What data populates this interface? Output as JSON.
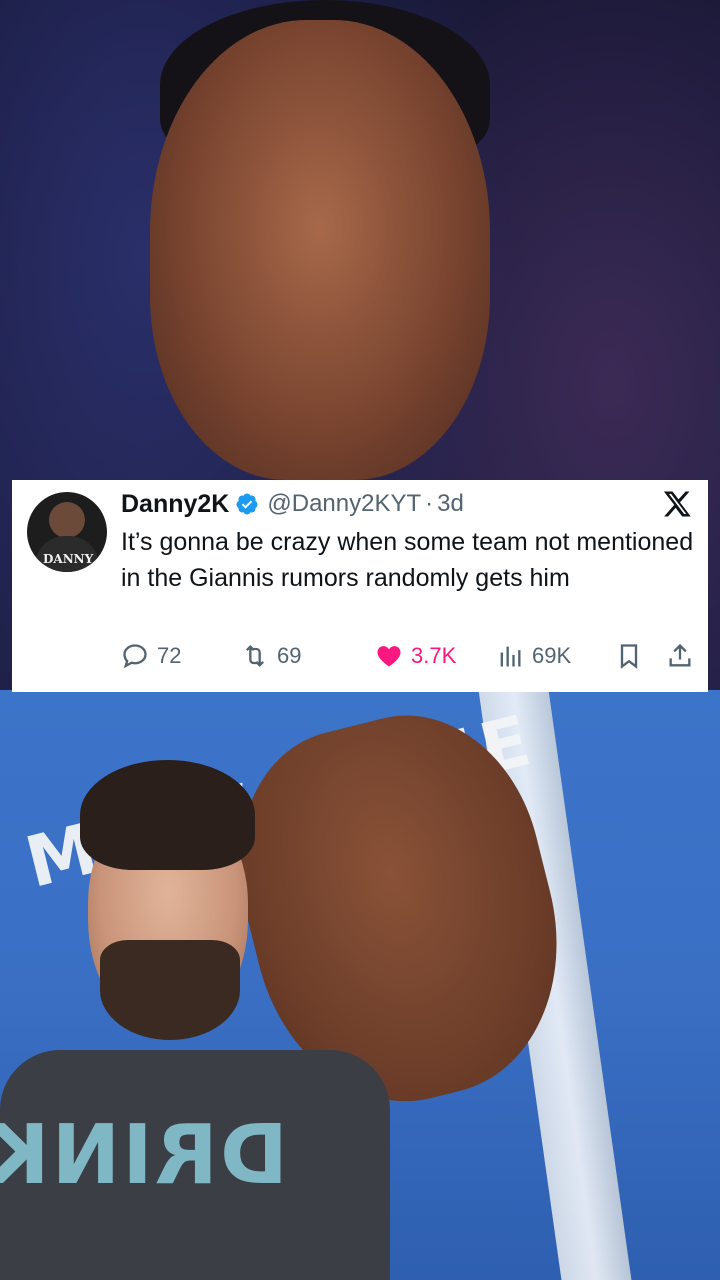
{
  "post": {
    "display_name": "Danny2K",
    "handle": "@Danny2KYT",
    "separator": "·",
    "time": "3d",
    "text": "It’s gonna be crazy when some team not mentioned in the Giannis rumors randomly gets him",
    "avatar_label": "DANNY",
    "replies": "72",
    "reposts": "69",
    "likes": "3.7K",
    "views": "69K"
  },
  "background": {
    "jersey_text": "MILWAUKEE",
    "shirt_text": "DRINK"
  },
  "colors": {
    "verified": "#1d9bf0",
    "like": "#f91880",
    "muted": "#536471",
    "jersey": "#3a6fc4"
  },
  "icons": {
    "verified": "verified-badge-icon",
    "platform": "x-logo-icon",
    "reply": "reply-icon",
    "repost": "repost-icon",
    "like": "heart-icon",
    "views": "views-icon",
    "bookmark": "bookmark-icon",
    "share": "share-icon"
  }
}
